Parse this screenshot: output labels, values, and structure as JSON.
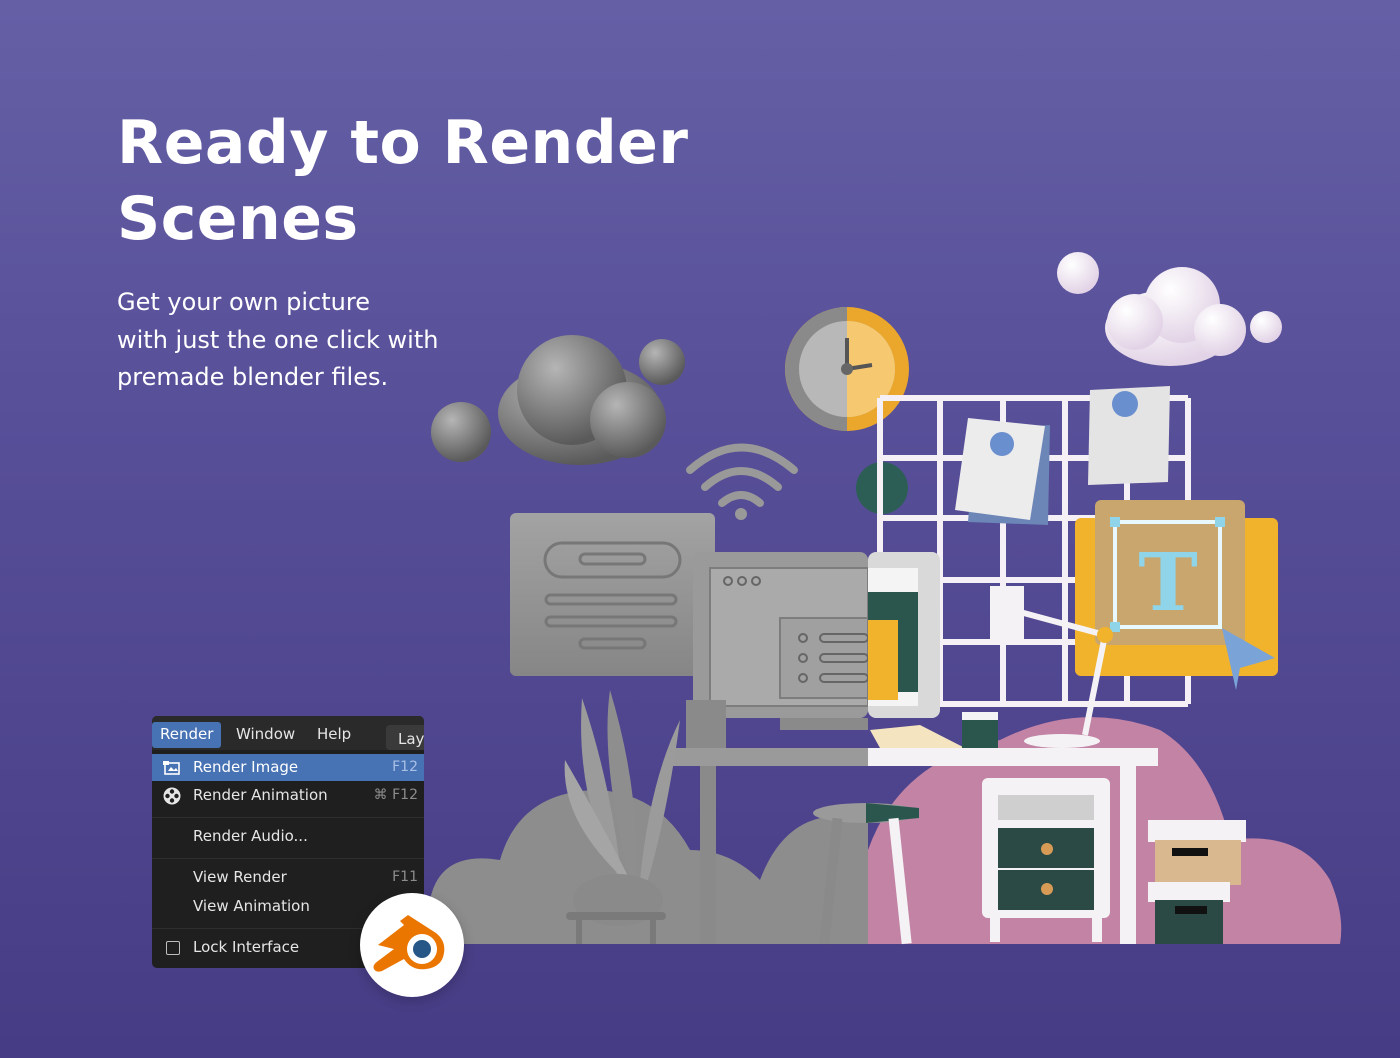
{
  "hero": {
    "title_line1": "Ready to Render",
    "title_line2": "Scenes",
    "subtitle_line1": "Get your own picture",
    "subtitle_line2": "with just the one click with",
    "subtitle_line3": "premade blender files."
  },
  "menu": {
    "topbar": [
      "Render",
      "Window",
      "Help",
      "Lay"
    ],
    "items": [
      {
        "label": "Render Image",
        "shortcut": "F12",
        "icon": "render-image-icon",
        "highlighted": true
      },
      {
        "label": "Render Animation",
        "shortcut": "⌘ F12",
        "icon": "render-animation-icon"
      },
      {
        "label": "Render Audio...",
        "shortcut": ""
      },
      {
        "label": "View Render",
        "shortcut": "F11"
      },
      {
        "label": "View Animation",
        "shortcut": "⌘"
      },
      {
        "label": "Lock Interface",
        "shortcut": "",
        "checkbox": false
      }
    ]
  },
  "scene": {
    "letter": "T"
  },
  "colors": {
    "background_top": "#6560a6",
    "background_bottom": "#463c85",
    "highlight": "#4772b3",
    "menu_bg": "#1f1f1f",
    "pink": "#c283a5",
    "clay": "#8a8a8a",
    "blender_orange": "#ea7600",
    "blender_blue": "#265787"
  }
}
